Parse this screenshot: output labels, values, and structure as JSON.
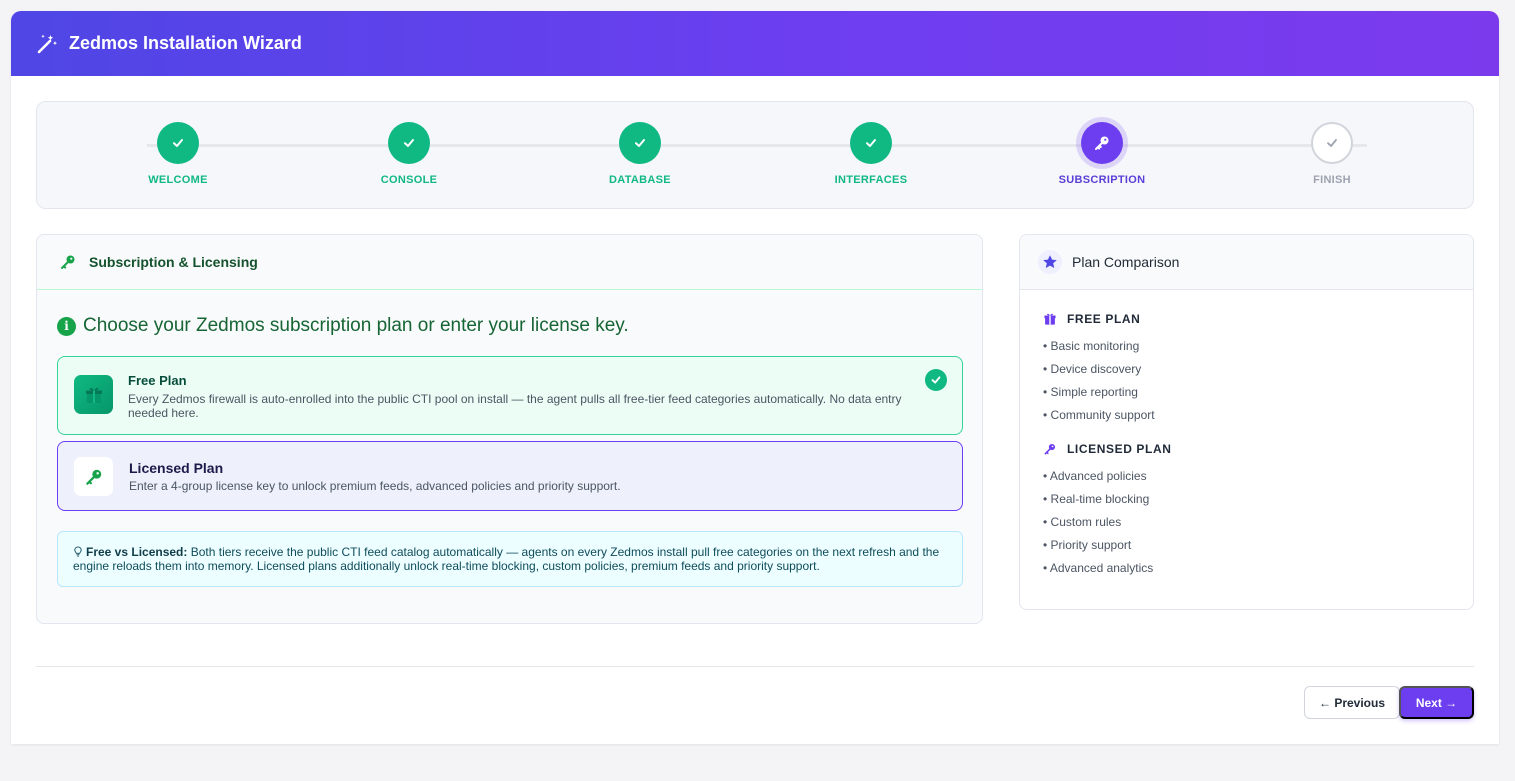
{
  "app": {
    "title": "Zedmos Installation Wizard",
    "icon": "magic-wand-icon"
  },
  "steps": [
    {
      "label": "WELCOME",
      "state": "done"
    },
    {
      "label": "CONSOLE",
      "state": "done"
    },
    {
      "label": "DATABASE",
      "state": "done"
    },
    {
      "label": "INTERFACES",
      "state": "done"
    },
    {
      "label": "SUBSCRIPTION",
      "state": "active"
    },
    {
      "label": "FINISH",
      "state": "pending"
    }
  ],
  "main": {
    "title": "Subscription & Licensing",
    "intro": "Choose your Zedmos subscription plan or enter your license key.",
    "plans": [
      {
        "title": "Free Plan",
        "description": "Every Zedmos firewall is auto-enrolled into the public CTI pool on install — the agent pulls all free-tier feed categories automatically. No data entry needed here.",
        "selected": true
      },
      {
        "title": "Licensed Plan",
        "description": "Enter a 4-group license key to unlock premium feeds, advanced policies and priority support.",
        "selected": false
      }
    ],
    "tip": {
      "label": "Free vs Licensed:",
      "text": " Both tiers receive the public CTI feed catalog automatically — agents on every Zedmos install pull free categories on the next refresh and the engine reloads them into memory. Licensed plans additionally unlock real-time blocking, custom policies, premium feeds and priority support."
    }
  },
  "comparison": {
    "title": "Plan Comparison",
    "free": {
      "title": "FREE PLAN",
      "features": [
        "• Basic monitoring",
        "• Device discovery",
        "• Simple reporting",
        "• Community support"
      ]
    },
    "licensed": {
      "title": "LICENSED PLAN",
      "features": [
        "• Advanced policies",
        "• Real-time blocking",
        "• Custom rules",
        "• Priority support",
        "• Advanced analytics"
      ]
    }
  },
  "nav": {
    "previous": "← Previous",
    "next": "Next →"
  },
  "colors": {
    "accent": "#6d3ef0",
    "success": "#10b981"
  }
}
